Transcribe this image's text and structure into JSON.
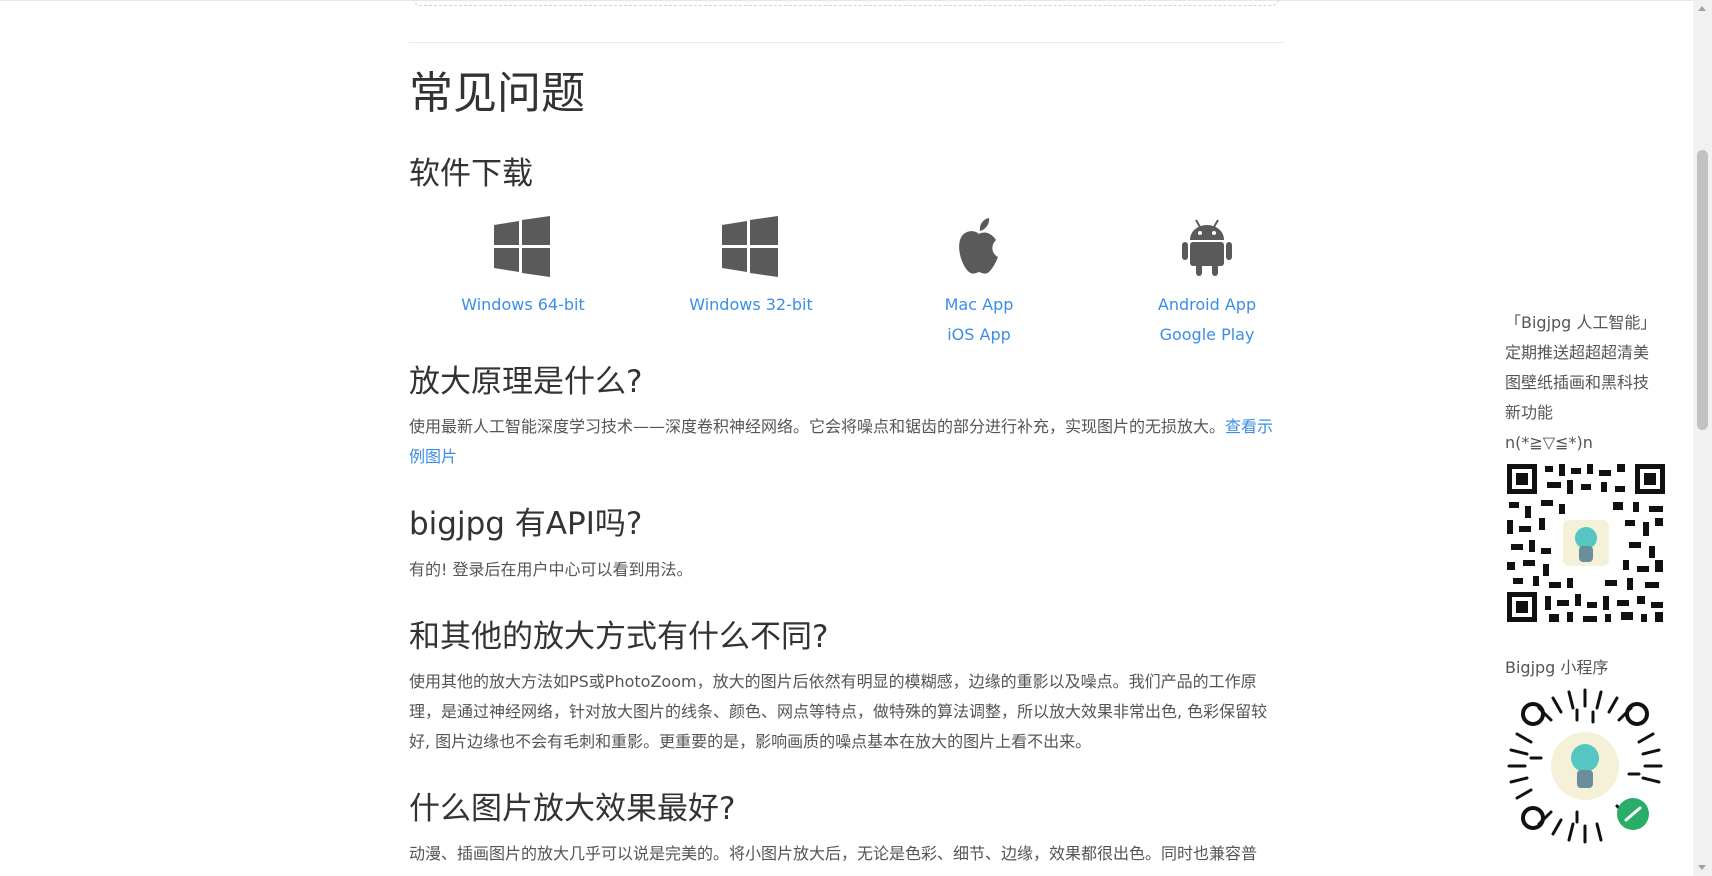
{
  "faq": {
    "title": "常见问题",
    "download": {
      "heading": "软件下载",
      "items": [
        {
          "icon": "windows-icon",
          "links": [
            "Windows 64-bit"
          ]
        },
        {
          "icon": "windows-icon",
          "links": [
            "Windows 32-bit"
          ]
        },
        {
          "icon": "apple-icon",
          "links": [
            "Mac App",
            "iOS App"
          ]
        },
        {
          "icon": "android-icon",
          "links": [
            "Android App",
            "Google Play"
          ]
        }
      ]
    },
    "principle": {
      "heading": "放大原理是什么?",
      "text": "使用最新人工智能深度学习技术——深度卷积神经网络。它会将噪点和锯齿的部分进行补充，实现图片的无损放大。",
      "link": "查看示例图片"
    },
    "api": {
      "heading": "bigjpg 有API吗?",
      "text": "有的! 登录后在用户中心可以看到用法。"
    },
    "diff": {
      "heading": "和其他的放大方式有什么不同?",
      "text": "使用其他的放大方法如PS或PhotoZoom，放大的图片后依然有明显的模糊感，边缘的重影以及噪点。我们产品的工作原理，是通过神经网络，针对放大图片的线条、颜色、网点等特点，做特殊的算法调整，所以放大效果非常出色, 色彩保留较好, 图片边缘也不会有毛刺和重影。更重要的是，影响画质的噪点基本在放大的图片上看不出来。"
    },
    "best": {
      "heading": "什么图片放大效果最好?",
      "text": "动漫、插画图片的放大几乎可以说是完美的。将小图片放大后，无论是色彩、细节、边缘，效果都很出色。同时也兼容普"
    }
  },
  "sidebar": {
    "lines": [
      "「Bigjpg 人工智能」",
      "定期推送超超超清美",
      "图壁纸插画和黑科技",
      "新功能",
      "n(*≧▽≦*)n"
    ],
    "mini_program_label": "Bigjpg 小程序"
  },
  "colors": {
    "link": "#3a8ee6",
    "text": "#555555",
    "heading": "#333333",
    "icon": "#5a5a5a"
  }
}
